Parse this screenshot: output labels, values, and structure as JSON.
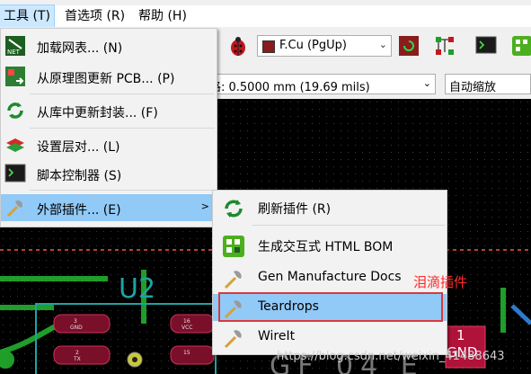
{
  "menubar": {
    "items": [
      "工具 (T)",
      "首选项 (R)",
      "帮助 (H)"
    ],
    "window_title_fragment": "..."
  },
  "toolbar": {
    "layer_value": "F.Cu (PgUp)",
    "layer_color": "#8a1c1c"
  },
  "toolbar2": {
    "grid_value": "格: 0.5000 mm (19.69 mils)",
    "zoom_value": "自动缩放"
  },
  "tools_menu": {
    "items": [
      {
        "label": "加载网表... (N)",
        "icon": "netlist-icon"
      },
      {
        "label": "从原理图更新 PCB... (P)",
        "icon": "update-pcb-icon"
      },
      {
        "label": "从库中更新封装... (F)",
        "icon": "refresh-footprint-icon"
      },
      {
        "label": "设置层对... (L)",
        "icon": "layer-pair-icon"
      },
      {
        "label": "脚本控制器 (S)",
        "icon": "console-icon"
      },
      {
        "label": "外部插件... (E)",
        "icon": "plugin-tool-icon"
      }
    ],
    "submenu_arrow": ">"
  },
  "plugins_menu": {
    "items": [
      {
        "label": "刷新插件 (R)",
        "icon": "refresh-icon"
      },
      {
        "label": "生成交互式 HTML BOM",
        "icon": "ibom-icon"
      },
      {
        "label": "Gen Manufacture Docs",
        "icon": "plugin-tool-icon"
      },
      {
        "label": "Teardrops",
        "icon": "plugin-tool-icon"
      },
      {
        "label": "WireIt",
        "icon": "plugin-tool-icon"
      }
    ]
  },
  "canvas": {
    "u2_label": "U2",
    "pad_labels": [
      "3",
      "GND",
      "16",
      "VCC",
      "2",
      "TX",
      "15",
      "1",
      "GND"
    ],
    "bottom_text": "GF 04 E"
  },
  "annotation": "泪滴插件",
  "watermark": "https://blog.csdn.net/weixin_41488643",
  "colors": {
    "highlight": "#91c9f7",
    "annotation_red": "#ff2a2a",
    "pcb_background": "#000000",
    "silkscreen": "#1fa3a3",
    "pad_red": "#b0123a",
    "track_green": "#1f9e2a"
  }
}
